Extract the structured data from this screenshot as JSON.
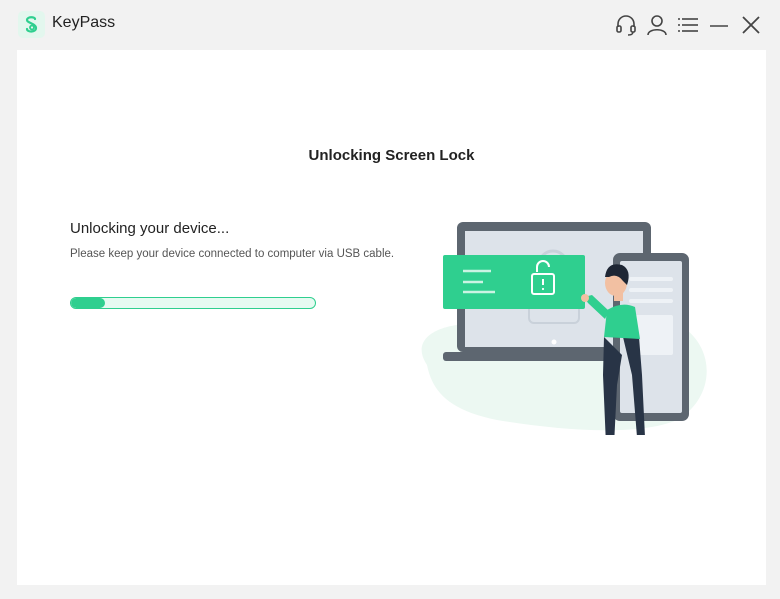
{
  "app": {
    "title": "KeyPass",
    "brand_color": "#2fcf8f"
  },
  "toolbar": {
    "icons": [
      "headset-icon",
      "user-icon",
      "menu-icon",
      "minimize-icon",
      "close-icon"
    ]
  },
  "main": {
    "heading": "Unlocking Screen Lock",
    "status_title": "Unlocking your device...",
    "status_subtitle": "Please keep your device connected to computer via USB cable.",
    "progress_fraction": 0.14
  }
}
